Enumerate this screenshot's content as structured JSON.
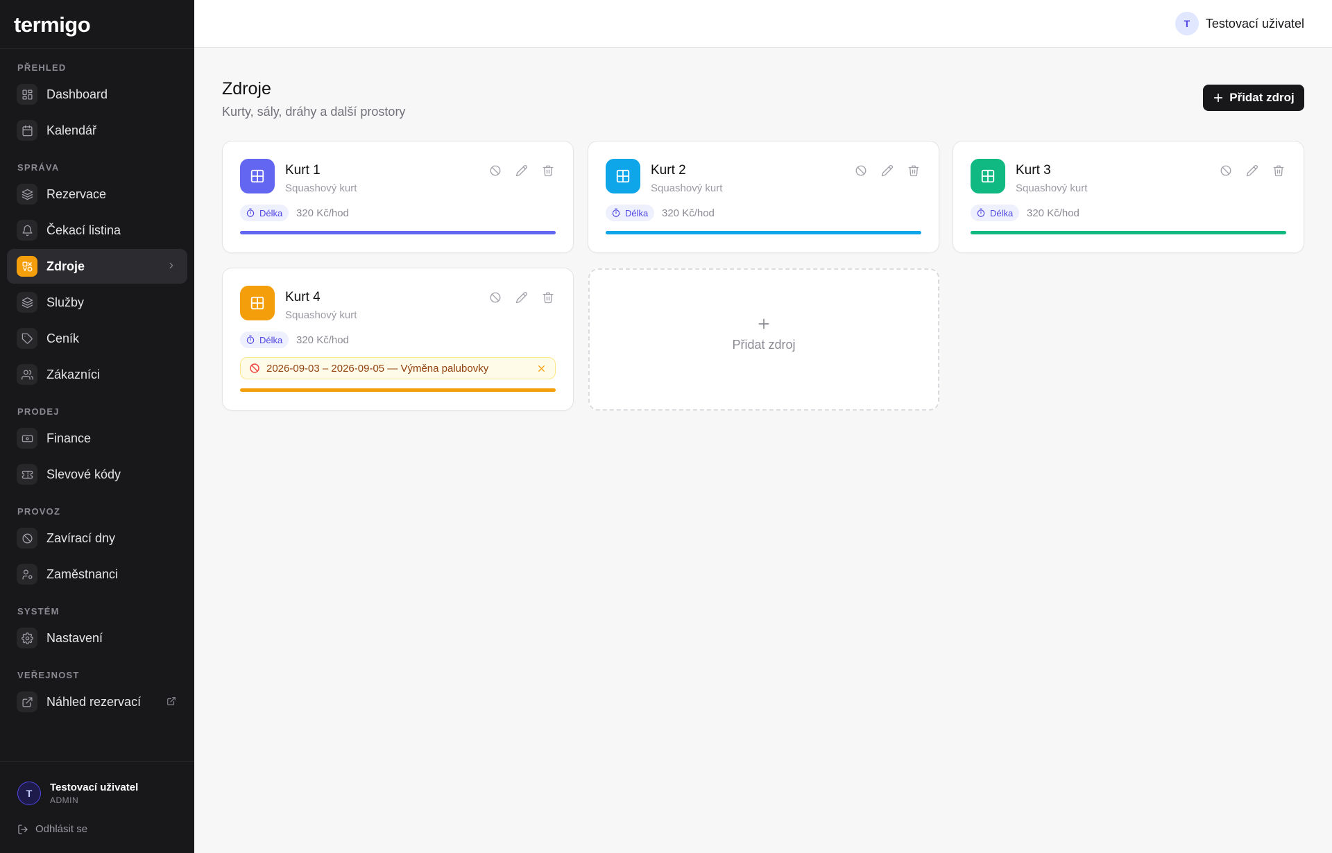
{
  "app": {
    "logo": "termigo"
  },
  "sidebar": {
    "sections": [
      {
        "label": "PŘEHLED",
        "items": [
          {
            "label": "Dashboard",
            "icon": "dashboard-icon"
          },
          {
            "label": "Kalendář",
            "icon": "calendar-icon"
          }
        ]
      },
      {
        "label": "SPRÁVA",
        "items": [
          {
            "label": "Rezervace",
            "icon": "layers-icon"
          },
          {
            "label": "Čekací listina",
            "icon": "bell-icon"
          },
          {
            "label": "Zdroje",
            "icon": "resources-icon",
            "active": true
          },
          {
            "label": "Služby",
            "icon": "layers-icon"
          },
          {
            "label": "Ceník",
            "icon": "tag-icon"
          },
          {
            "label": "Zákazníci",
            "icon": "users-icon"
          }
        ]
      },
      {
        "label": "PRODEJ",
        "items": [
          {
            "label": "Finance",
            "icon": "banknote-icon"
          },
          {
            "label": "Slevové kódy",
            "icon": "ticket-icon"
          }
        ]
      },
      {
        "label": "PROVOZ",
        "items": [
          {
            "label": "Zavírací dny",
            "icon": "ban-icon"
          },
          {
            "label": "Zaměstnanci",
            "icon": "user-cog-icon"
          }
        ]
      },
      {
        "label": "SYSTÉM",
        "items": [
          {
            "label": "Nastavení",
            "icon": "gear-icon"
          }
        ]
      },
      {
        "label": "VEŘEJNOST",
        "items": [
          {
            "label": "Náhled rezervací",
            "icon": "external-link-icon",
            "external": true
          }
        ]
      }
    ],
    "footer": {
      "avatar_initial": "T",
      "user_name": "Testovací uživatel",
      "role": "ADMIN",
      "logout_label": "Odhlásit se"
    }
  },
  "topbar": {
    "avatar_initial": "T",
    "user_name": "Testovací uživatel"
  },
  "page": {
    "title": "Zdroje",
    "subtitle": "Kurty, sály, dráhy a další prostory",
    "add_button_label": "Přidat zdroj"
  },
  "resources": [
    {
      "name": "Kurt 1",
      "type": "Squashový kurt",
      "tag": "Délka",
      "price": "320 Kč/hod",
      "color": "#6366f1",
      "icon_color": "#6366f1"
    },
    {
      "name": "Kurt 2",
      "type": "Squashový kurt",
      "tag": "Délka",
      "price": "320 Kč/hod",
      "color": "#0ea5e9",
      "icon_color": "#0ea5e9"
    },
    {
      "name": "Kurt 3",
      "type": "Squashový kurt",
      "tag": "Délka",
      "price": "320 Kč/hod",
      "color": "#10b981",
      "icon_color": "#10b981"
    },
    {
      "name": "Kurt 4",
      "type": "Squashový kurt",
      "tag": "Délka",
      "price": "320 Kč/hod",
      "color": "#f59e0b",
      "icon_color": "#f59e0b",
      "closure": "2026-09-03 – 2026-09-05 — Výměna palubovky"
    }
  ],
  "add_card": {
    "label": "Přidat zdroj"
  },
  "colors": {
    "sidebar_bg": "#18181b",
    "accent": "#f59e0b",
    "button_bg": "#18181b",
    "tag_bg": "#eef0fd",
    "tag_fg": "#4f46e5",
    "closure_bg": "#fefce8",
    "closure_fg": "#92400e",
    "closure_icon": "#ef4444"
  }
}
